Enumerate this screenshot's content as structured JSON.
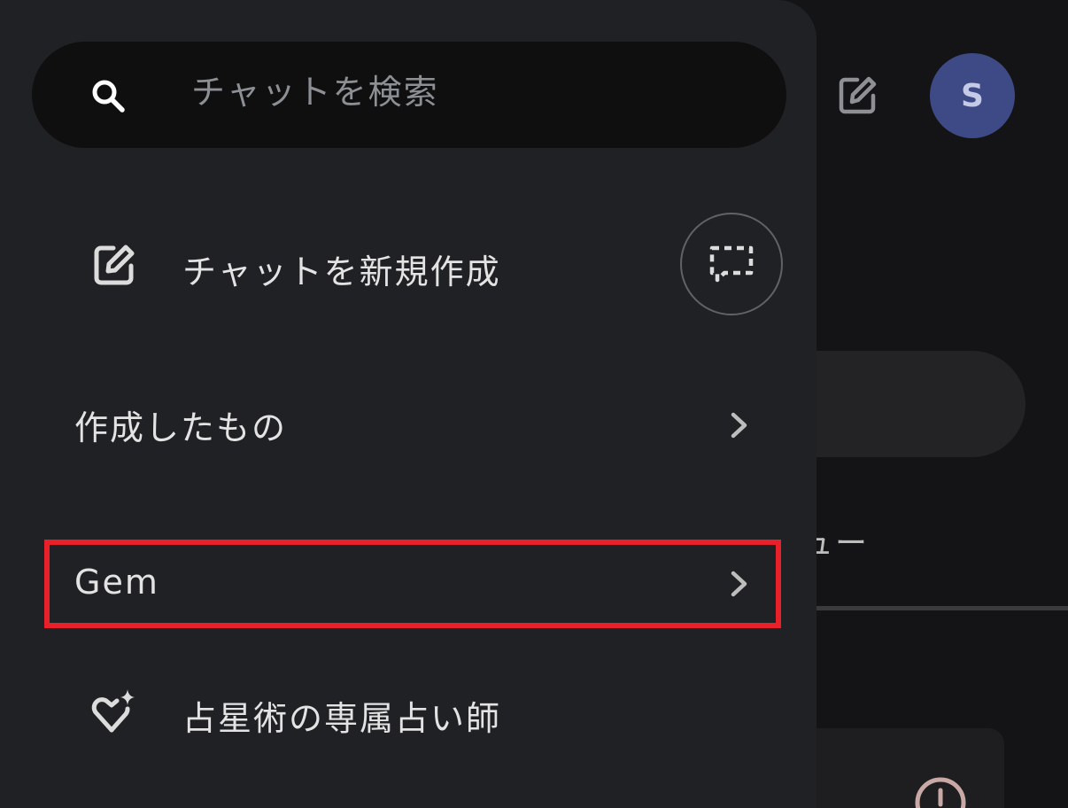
{
  "colors": {
    "drawer_bg": "#202124",
    "search_bg": "#0f0f10",
    "avatar_bg": "#3e4a86",
    "highlight": "#e8202a",
    "text": "#e3e3e3"
  },
  "background": {
    "avatar_initial": "S",
    "menu_label_fragment": "ュー",
    "edit_icon": "edit-square-icon",
    "alert_icon": "alert-circle-icon"
  },
  "drawer": {
    "search": {
      "placeholder": "チャットを検索",
      "icon": "search-icon"
    },
    "new_chat": {
      "label": "チャットを新規作成",
      "icon": "edit-square-icon",
      "temp_chat_icon": "temporary-chat-icon"
    },
    "items": [
      {
        "label": "作成したもの",
        "chevron": "chevron-right-icon"
      },
      {
        "label": "Gem",
        "chevron": "chevron-right-icon",
        "highlighted": true
      }
    ],
    "gem_entry": {
      "label": "占星術の専属占い師",
      "icon": "gem-heart-sparkle-icon"
    }
  }
}
